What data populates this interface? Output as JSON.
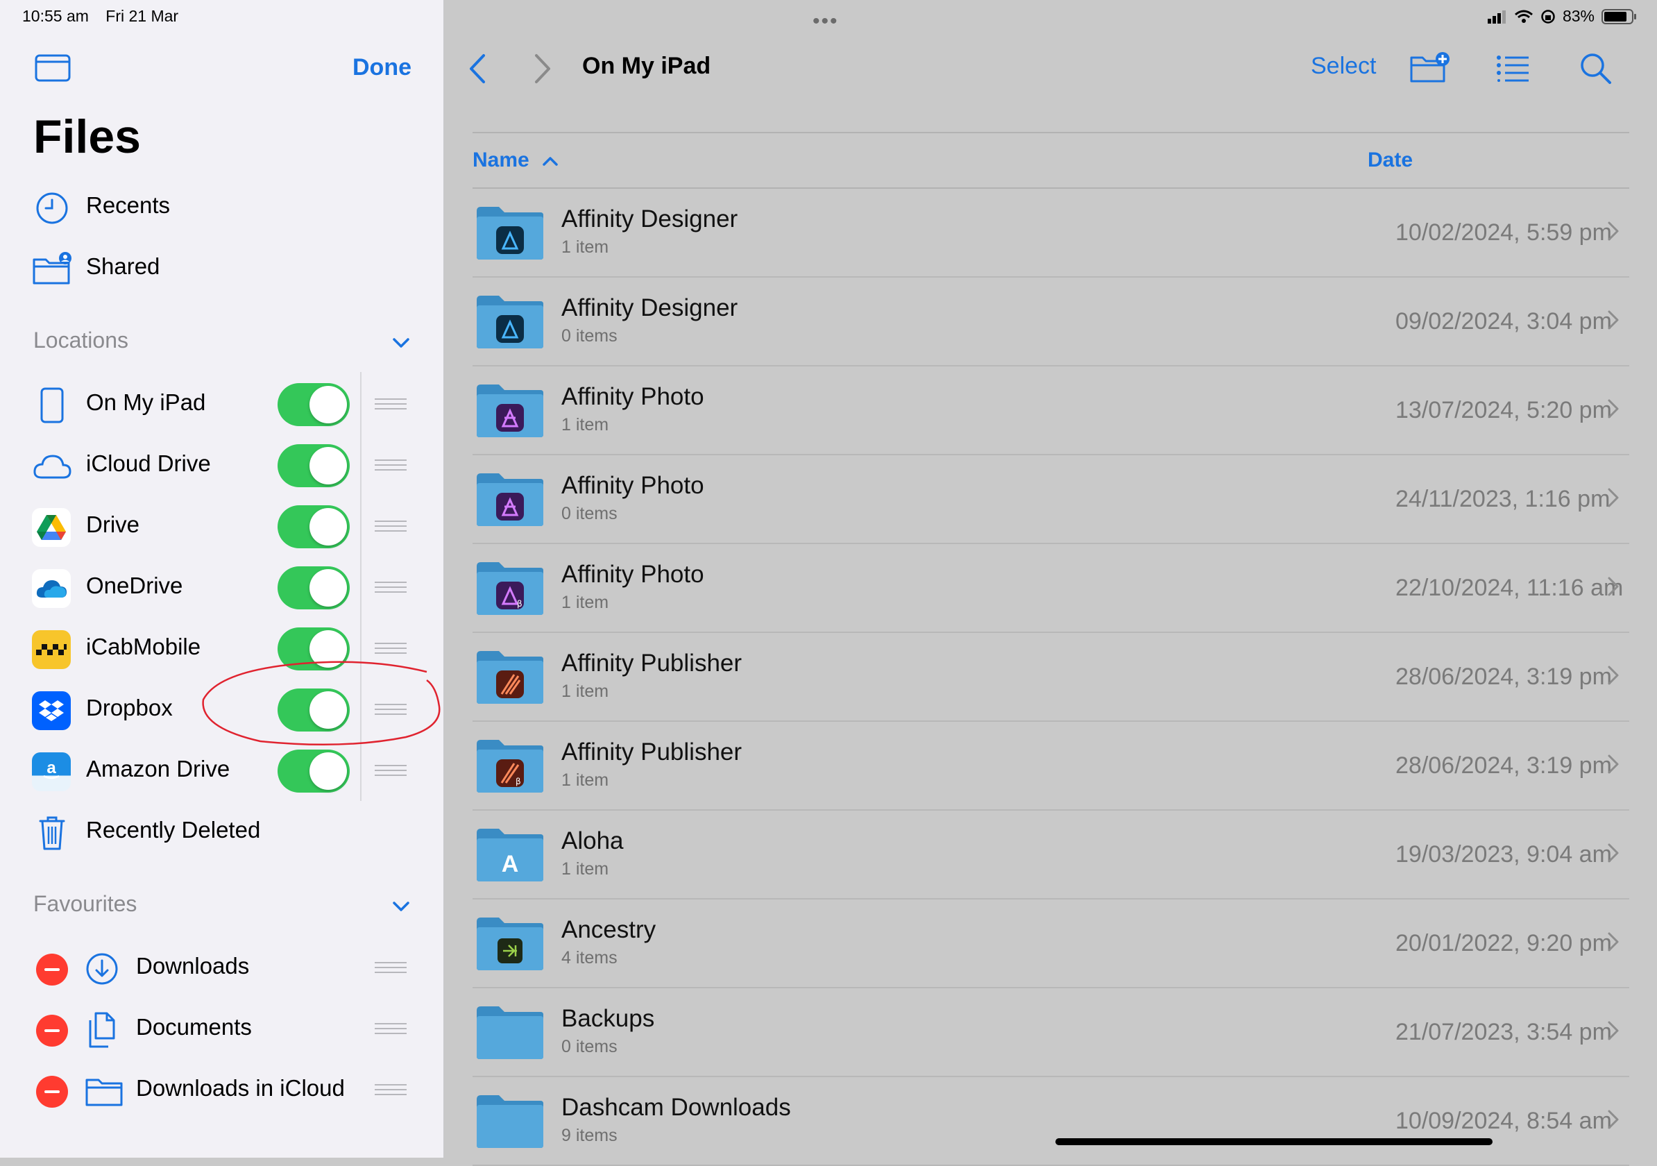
{
  "status_bar": {
    "time": "10:55 am",
    "date": "Fri 21 Mar",
    "battery": "83%",
    "icons": [
      "signal-icon",
      "wifi-icon",
      "orientation-lock-icon",
      "battery-icon"
    ]
  },
  "sidebar": {
    "done_label": "Done",
    "title": "Files",
    "top_items": [
      {
        "label": "Recents",
        "icon": "clock-icon"
      },
      {
        "label": "Shared",
        "icon": "shared-folder-icon"
      }
    ],
    "locations_header": "Locations",
    "locations": [
      {
        "label": "On My iPad",
        "icon": "ipad-icon",
        "enabled": true
      },
      {
        "label": "iCloud Drive",
        "icon": "icloud-icon",
        "enabled": true
      },
      {
        "label": "Drive",
        "icon": "google-drive-icon",
        "enabled": true
      },
      {
        "label": "OneDrive",
        "icon": "onedrive-icon",
        "enabled": true
      },
      {
        "label": "iCabMobile",
        "icon": "icabmobile-icon",
        "enabled": true
      },
      {
        "label": "Dropbox",
        "icon": "dropbox-icon",
        "enabled": true
      },
      {
        "label": "Amazon Drive",
        "icon": "amazon-drive-icon",
        "enabled": true
      }
    ],
    "recently_deleted": {
      "label": "Recently Deleted",
      "icon": "trash-icon"
    },
    "favourites_header": "Favourites",
    "favourites": [
      {
        "label": "Downloads",
        "icon": "download-circle-icon"
      },
      {
        "label": "Documents",
        "icon": "documents-icon"
      },
      {
        "label": "Downloads in iCloud",
        "icon": "folder-icon"
      }
    ]
  },
  "main": {
    "location_title": "On My iPad",
    "select_label": "Select",
    "columns": {
      "name": "Name",
      "date": "Date"
    },
    "sort": {
      "column": "Name",
      "direction": "ascending"
    },
    "files": [
      {
        "name": "Affinity Designer",
        "count": "1 item",
        "date": "10/02/2024, 5:59 pm",
        "badge": "affinity-designer-icon"
      },
      {
        "name": "Affinity Designer",
        "count": "0 items",
        "date": "09/02/2024, 3:04 pm",
        "badge": "affinity-designer-icon"
      },
      {
        "name": "Affinity Photo",
        "count": "1 item",
        "date": "13/07/2024, 5:20 pm",
        "badge": "affinity-photo-icon"
      },
      {
        "name": "Affinity Photo",
        "count": "0 items",
        "date": "24/11/2023, 1:16 pm",
        "badge": "affinity-photo-icon"
      },
      {
        "name": "Affinity Photo",
        "count": "1 item",
        "date": "22/10/2024, 11:16 am",
        "badge": "affinity-photo-beta-icon"
      },
      {
        "name": "Affinity Publisher",
        "count": "1 item",
        "date": "28/06/2024, 3:19 pm",
        "badge": "affinity-publisher-icon"
      },
      {
        "name": "Affinity Publisher",
        "count": "1 item",
        "date": "28/06/2024, 3:19 pm",
        "badge": "affinity-publisher-beta-icon"
      },
      {
        "name": "Aloha",
        "count": "1 item",
        "date": "19/03/2023, 9:04 am",
        "badge": "aloha-icon"
      },
      {
        "name": "Ancestry",
        "count": "4 items",
        "date": "20/01/2022, 9:20 pm",
        "badge": "ancestry-icon"
      },
      {
        "name": "Backups",
        "count": "0 items",
        "date": "21/07/2023, 3:54 pm",
        "badge": ""
      },
      {
        "name": "Dashcam Downloads",
        "count": "9 items",
        "date": "10/09/2024, 8:54 am",
        "badge": ""
      }
    ]
  },
  "colors": {
    "accent": "#1a73e0",
    "toggle_on": "#34c759",
    "delete_red": "#ff3b30",
    "annotation_red": "#e0232f",
    "folder_blue": "#4a9fd4"
  }
}
